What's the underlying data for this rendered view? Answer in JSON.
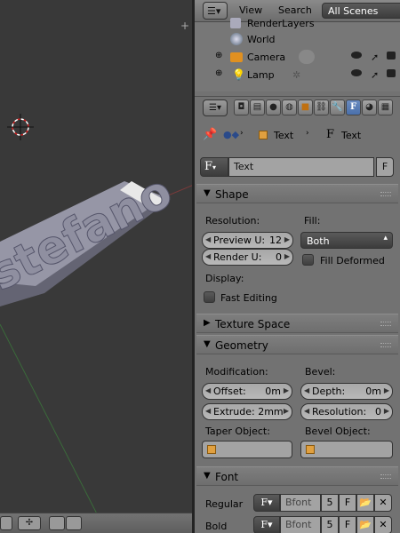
{
  "header": {
    "editor_icon": "outliner-editor-icon",
    "menu_view": "View",
    "menu_search": "Search",
    "scene_filter": "All Scenes"
  },
  "outliner": {
    "items": [
      {
        "label": "RenderLayers",
        "icon": "renderlayers-icon"
      },
      {
        "label": "World",
        "icon": "world-icon"
      },
      {
        "label": "Camera",
        "icon": "camera-icon"
      },
      {
        "label": "Lamp",
        "icon": "lamp-icon"
      }
    ]
  },
  "breadcrumbs": {
    "obj": "Text",
    "data": "Text"
  },
  "datablock": {
    "name": "Text",
    "f_label": "F"
  },
  "shape": {
    "title": "Shape",
    "resolution_label": "Resolution:",
    "preview_u_label": "Preview U:",
    "preview_u_value": "12",
    "render_u_label": "Render U:",
    "render_u_value": "0",
    "fill_label": "Fill:",
    "fill_value": "Both",
    "fill_deformed_label": "Fill Deformed",
    "display_label": "Display:",
    "fast_editing_label": "Fast Editing"
  },
  "texture_space": {
    "title": "Texture Space"
  },
  "geometry": {
    "title": "Geometry",
    "modification_label": "Modification:",
    "bevel_label": "Bevel:",
    "offset_label": "Offset:",
    "offset_value": "0m",
    "extrude_label": "Extrude: 2mm",
    "depth_label": "Depth:",
    "depth_value": "0m",
    "resolution_label": "Resolution:",
    "resolution_value": "0",
    "taper_label": "Taper Object:",
    "bevel_obj_label": "Bevel Object:"
  },
  "font": {
    "title": "Font",
    "regular_label": "Regular",
    "regular_font": "Bfont",
    "regular_users": "5",
    "bold_label": "Bold",
    "bold_font": "Bfont",
    "bold_users": "5",
    "f_btn": "F"
  },
  "viewport": {
    "text_object": "stefano"
  },
  "colors": {
    "panel_bg": "#727272",
    "viewport_bg": "#393939",
    "accent": "#4a70ab"
  }
}
